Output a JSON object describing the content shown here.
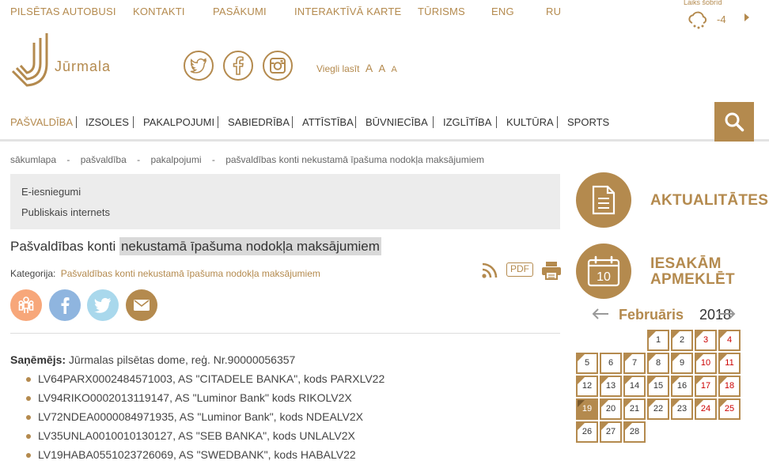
{
  "topnav": [
    "PILSĒTAS AUTOBUSI",
    "KONTAKTI",
    "PASĀKUMI",
    "INTERAKTĪVĀ KARTE",
    "TŪRISMS",
    "ENG",
    "RU"
  ],
  "weather": {
    "label": "Laiks šobrīd",
    "temp": "-4"
  },
  "logo": {
    "text": "Jūrmala"
  },
  "easy_read": {
    "label": "Viegli lasīt",
    "a1": "A",
    "a2": "A",
    "a3": "A"
  },
  "mainnav": [
    "PAŠVALDĪBA",
    "IZSOLES",
    "PAKALPOJUMI",
    "SABIEDRĪBA",
    "ATTĪSTĪBA",
    "BŪVNIECĪBA",
    "IZGLĪTĪBA",
    "KULTŪRA",
    "SPORTS"
  ],
  "breadcrumb": [
    "sākumlapa",
    "-",
    "pašvaldība",
    "-",
    "pakalpojumi",
    "-",
    "pašvaldības konti nekustamā īpašuma nodokļa maksājumiem"
  ],
  "grey_links": [
    "E-iesniegumi",
    "Publiskais internets"
  ],
  "page": {
    "title_a": "Pašvaldības konti ",
    "title_b": "nekustamā īpašuma nodokļa maksājumiem",
    "category_label": "Kategorija:",
    "category_value": "Pašvaldības konti nekustamā īpašuma nodokļa maksājumiem",
    "pdf": "PDF"
  },
  "recipient": {
    "label": "Saņēmējs:",
    "value": " Jūrmalas pilsētas dome, reģ. Nr.90000056357"
  },
  "accounts": [
    "LV64PARX0002484571003, AS \"CITADELE BANKA\", kods PARXLV22",
    "LV94RIKO0002013119147, AS \"Luminor Bank\" kods RIKOLV2X",
    "LV72NDEA0000084971935, AS \"Luminor Bank\", kods NDEALV2X",
    "LV35UNLA0010010130127, AS \"SEB BANKA\", kods UNLALV2X",
    "LV19HABA0551023726069, AS \"SWEDBANK\", kods HABALV22"
  ],
  "right": {
    "news": "AKTUALITĀTES",
    "visit_line1": "IESAKĀM",
    "visit_line2": "APMEKLĒT",
    "cal_icon_day": "10",
    "month": "Februāris",
    "year": "2018"
  },
  "calendar_days": [
    {
      "d": "1",
      "c": 3,
      "r": 0,
      "tri": true
    },
    {
      "d": "2",
      "c": 4,
      "r": 0,
      "tri": true
    },
    {
      "d": "3",
      "c": 5,
      "r": 0,
      "we": true,
      "tri": true
    },
    {
      "d": "4",
      "c": 6,
      "r": 0,
      "we": true,
      "tri": true
    },
    {
      "d": "5",
      "c": 0,
      "r": 1,
      "tri": true
    },
    {
      "d": "6",
      "c": 1,
      "r": 1
    },
    {
      "d": "7",
      "c": 2,
      "r": 1,
      "tri": true
    },
    {
      "d": "8",
      "c": 3,
      "r": 1,
      "tri": true
    },
    {
      "d": "9",
      "c": 4,
      "r": 1,
      "tri": true
    },
    {
      "d": "10",
      "c": 5,
      "r": 1,
      "we": true,
      "tri": true
    },
    {
      "d": "11",
      "c": 6,
      "r": 1,
      "we": true,
      "tri": true
    },
    {
      "d": "12",
      "c": 0,
      "r": 2,
      "tri": true
    },
    {
      "d": "13",
      "c": 1,
      "r": 2,
      "tri": true
    },
    {
      "d": "14",
      "c": 2,
      "r": 2,
      "tri": true
    },
    {
      "d": "15",
      "c": 3,
      "r": 2,
      "tri": true
    },
    {
      "d": "16",
      "c": 4,
      "r": 2,
      "tri": true
    },
    {
      "d": "17",
      "c": 5,
      "r": 2,
      "we": true,
      "tri": true
    },
    {
      "d": "18",
      "c": 6,
      "r": 2,
      "we": true,
      "tri": true
    },
    {
      "d": "19",
      "c": 0,
      "r": 3,
      "today": true
    },
    {
      "d": "20",
      "c": 1,
      "r": 3,
      "tri": true
    },
    {
      "d": "21",
      "c": 2,
      "r": 3,
      "tri": true
    },
    {
      "d": "22",
      "c": 3,
      "r": 3,
      "tri": true
    },
    {
      "d": "23",
      "c": 4,
      "r": 3,
      "tri": true
    },
    {
      "d": "24",
      "c": 5,
      "r": 3,
      "we": true,
      "tri": true
    },
    {
      "d": "25",
      "c": 6,
      "r": 3,
      "we": true,
      "tri": true
    },
    {
      "d": "26",
      "c": 0,
      "r": 4,
      "tri": true
    },
    {
      "d": "27",
      "c": 1,
      "r": 4,
      "tri": true
    },
    {
      "d": "28",
      "c": 2,
      "r": 4,
      "tri": true
    }
  ]
}
